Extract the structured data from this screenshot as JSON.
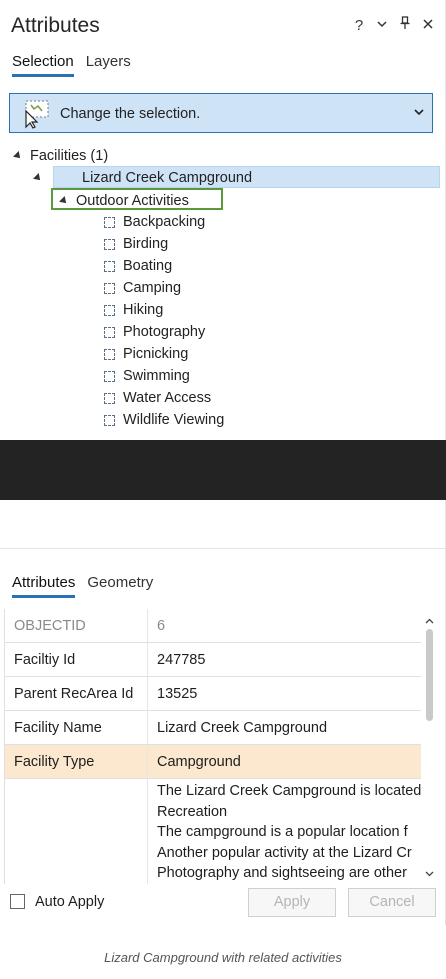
{
  "header": {
    "title": "Attributes",
    "help_icon": "?",
    "menu_icon": "chevron-down",
    "pin_icon": "pin",
    "close_icon": "x"
  },
  "top_tabs": [
    "Selection",
    "Layers"
  ],
  "change_selection": {
    "label": "Change the selection."
  },
  "tree": {
    "root": "Facilities (1)",
    "feature": "Lizard Creek Campground",
    "relationship": "Outdoor Activities",
    "activities": [
      "Backpacking",
      "Birding",
      "Boating",
      "Camping",
      "Hiking",
      "Photography",
      "Picnicking",
      "Swimming",
      "Water Access",
      "Wildlife Viewing"
    ]
  },
  "bottom_tabs": [
    "Attributes",
    "Geometry"
  ],
  "attributes": [
    {
      "key": "OBJECTID",
      "value": "6"
    },
    {
      "key": "Faciltiy Id",
      "value": "247785"
    },
    {
      "key": "Parent RecArea Id",
      "value": "13525"
    },
    {
      "key": "Facility Name",
      "value": "Lizard Creek Campground"
    },
    {
      "key": "Facility Type",
      "value": "Campground"
    }
  ],
  "description_lines": [
    "The Lizard Creek Campground is located",
    "Recreation",
    "The campground is a popular location f",
    "Another popular activity at the Lizard Cr",
    "Photography and sightseeing are other"
  ],
  "footer": {
    "auto_apply_label": "Auto Apply",
    "apply_label": "Apply",
    "cancel_label": "Cancel"
  },
  "caption": "Lizard Campground with related activities",
  "colors": {
    "accent": "#2b6fb6",
    "selection_bg": "#cfe3f7",
    "highlight_border": "#5b9a3c",
    "field_highlight": "#fbe8cf"
  }
}
